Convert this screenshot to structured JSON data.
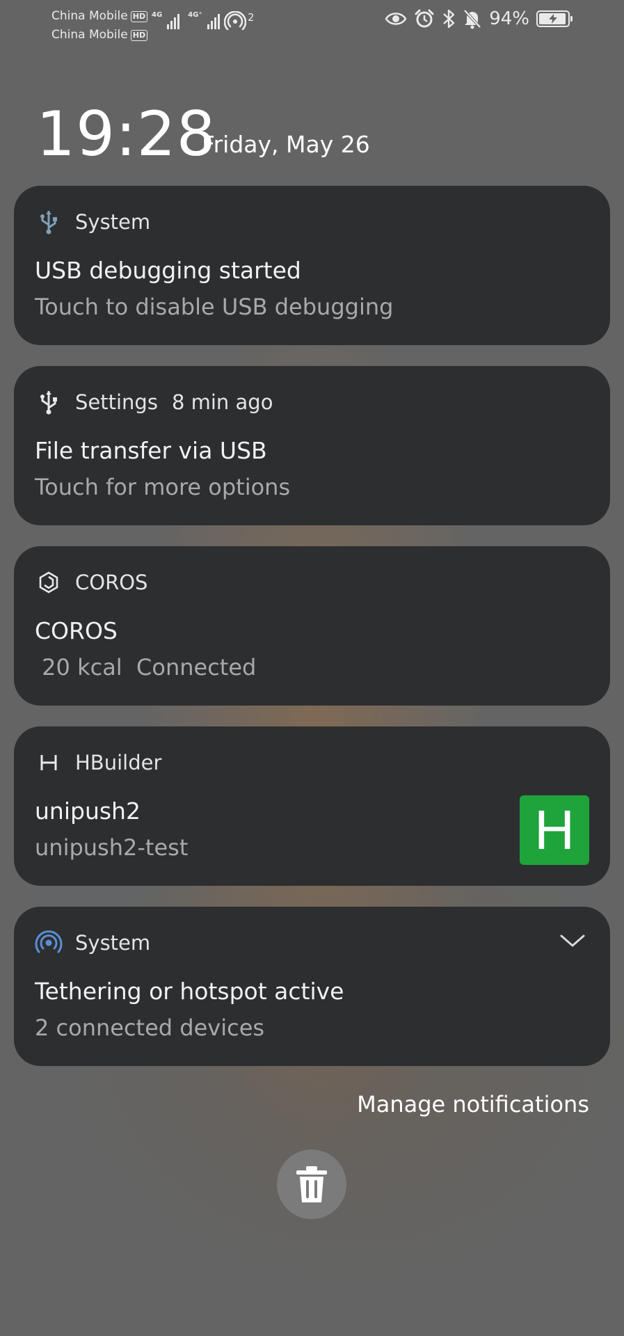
{
  "status_bar": {
    "carrier1": "China Mobile",
    "carrier2": "China Mobile",
    "hd_badge": "HD",
    "sim1_network": "4G",
    "sim2_network": "4G⁺",
    "hotspot_count": "2",
    "battery": "94%",
    "battery_level": 0.94,
    "icons": [
      "eye-icon",
      "alarm-icon",
      "bluetooth-icon",
      "mute-icon",
      "battery-charging-icon"
    ]
  },
  "lockscreen": {
    "time": "19:28",
    "date": "Friday, May 26"
  },
  "notifications": [
    {
      "app": "System",
      "time_ago": "",
      "title": "USB debugging started",
      "text": "Touch to disable USB debugging",
      "icon": "usb-icon"
    },
    {
      "app": "Settings",
      "time_ago": "8 min ago",
      "title": "File transfer via USB",
      "text": "Touch for more options",
      "icon": "usb-icon"
    },
    {
      "app": "COROS",
      "time_ago": "",
      "title": "COROS",
      "text": " 20 kcal  Connected",
      "icon": "coros-icon"
    },
    {
      "app": "HBuilder",
      "time_ago": "",
      "title": "unipush2",
      "text": "unipush2-test",
      "icon": "hbuilder-icon",
      "thumbnail_letter": "H",
      "thumbnail_color": "#1fa33b"
    },
    {
      "app": "System",
      "time_ago": "",
      "title": "Tethering or hotspot active",
      "text": "2 connected devices",
      "icon": "hotspot-icon"
    }
  ],
  "manage_label": "Manage notifications",
  "colors": {
    "card_bg": "#2d2e30",
    "hotspot_icon": "#5b8fd6",
    "usb_icon_system": "#7fa0b8"
  }
}
